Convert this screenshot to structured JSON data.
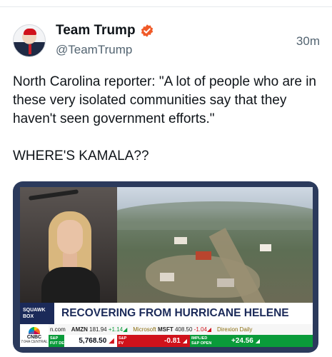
{
  "post": {
    "display_name": "Team Trump",
    "handle": "@TeamTrump",
    "timestamp": "30m",
    "body_line_1": "North Carolina reporter: \"A lot of people who are in these very isolated communities say that they haven't seen government efforts.\"",
    "body_line_2": "WHERE'S KAMALA??"
  },
  "media": {
    "show_badge_line_1": "SQUAWK",
    "show_badge_line_2": "BOX",
    "headline": "RECOVERING FROM HURRICANE HELENE",
    "network": "CNBC",
    "network_time": "7:04A CENTRAL",
    "stocks": {
      "s0_prefix": "n.com",
      "s1_sym": "AMZN",
      "s1_price": "181.94",
      "s1_change": "+1.14",
      "s2_sym": "Microsoft",
      "s2_ticker": "MSFT",
      "s2_price": "408.50",
      "s2_change": "-1.04",
      "s3_sym": "Direxion Daily"
    },
    "indices": {
      "sp_fut_label_1": "S&P",
      "sp_fut_label_2": "FUT DEC",
      "sp_fut_value": "5,768.50",
      "sp_fv_label_1": "S&P",
      "sp_fv_label_2": "FV",
      "sp_fv_value": "-0.81",
      "implied_label_1": "IMPLIED",
      "implied_label_2": "S&P OPEN",
      "implied_value": "+24.56"
    }
  },
  "colors": {
    "text_primary": "#0f1419",
    "text_secondary": "#536471",
    "verified_badge": "#f05a28",
    "headline_navy": "#1b2a59",
    "ticker_green": "#0a9b3a",
    "ticker_red": "#d0121b"
  },
  "icons": {
    "verified": "verified-badge-icon",
    "network_logo": "peacock-icon"
  }
}
